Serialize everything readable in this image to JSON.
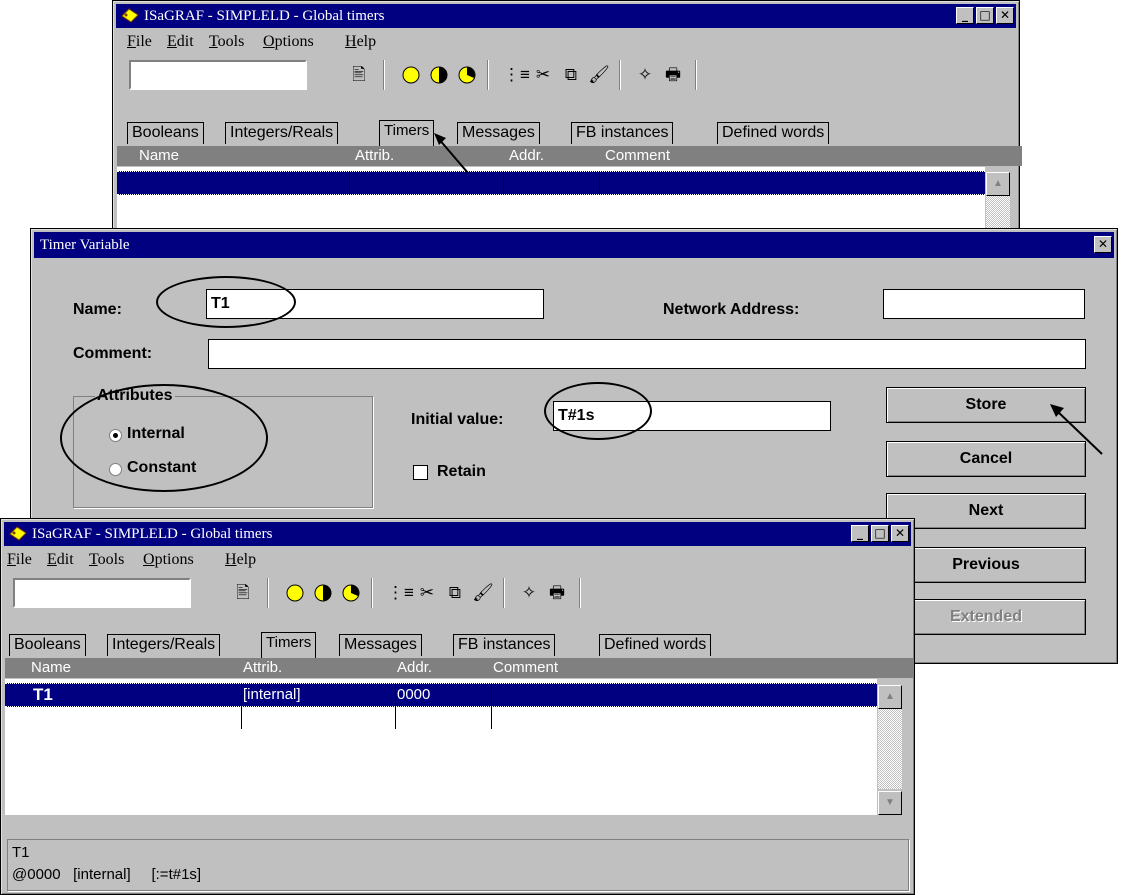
{
  "window": {
    "title": "ISaGRAF - SIMPLELD - Global timers",
    "menu": [
      "File",
      "Edit",
      "Tools",
      "Options",
      "Help"
    ],
    "tabs": [
      "Booleans",
      "Integers/Reals",
      "Timers",
      "Messages",
      "FB instances",
      "Defined words"
    ],
    "columns": [
      "Name",
      "Attrib.",
      "Addr.",
      "Comment"
    ]
  },
  "dialog": {
    "title": "Timer Variable",
    "close": "✕",
    "name_label": "Name:",
    "name_value": "T1",
    "network_label": "Network Address:",
    "network_value": "",
    "comment_label": "Comment:",
    "comment_value": "",
    "attributes_label": "Attributes",
    "internal_label": "Internal",
    "constant_label": "Constant",
    "initial_label": "Initial value:",
    "initial_value": "T#1s",
    "retain_label": "Retain",
    "buttons": {
      "store": "Store",
      "cancel": "Cancel",
      "next": "Next",
      "previous": "Previous",
      "extended": "Extended"
    }
  },
  "bottom_window": {
    "row": {
      "name": "T1",
      "attrib": "[internal]",
      "addr": "0000",
      "comment": ""
    },
    "status_line1": "T1",
    "status_line2": "@0000   [internal]     [:=t#1s]"
  },
  "colors": {
    "titlebar": "#000080",
    "face": "#c0c0c0",
    "grid_header": "#808080"
  },
  "icons": [
    "app-icon",
    "minimize-icon",
    "maximize-icon",
    "close-icon",
    "open-icon",
    "circle-icon",
    "half-circle-icon",
    "pie-icon",
    "list-icon",
    "scissors-icon",
    "copy-icon",
    "paint-icon",
    "wand-icon",
    "print-icon",
    "arrow-pointer-icon"
  ]
}
